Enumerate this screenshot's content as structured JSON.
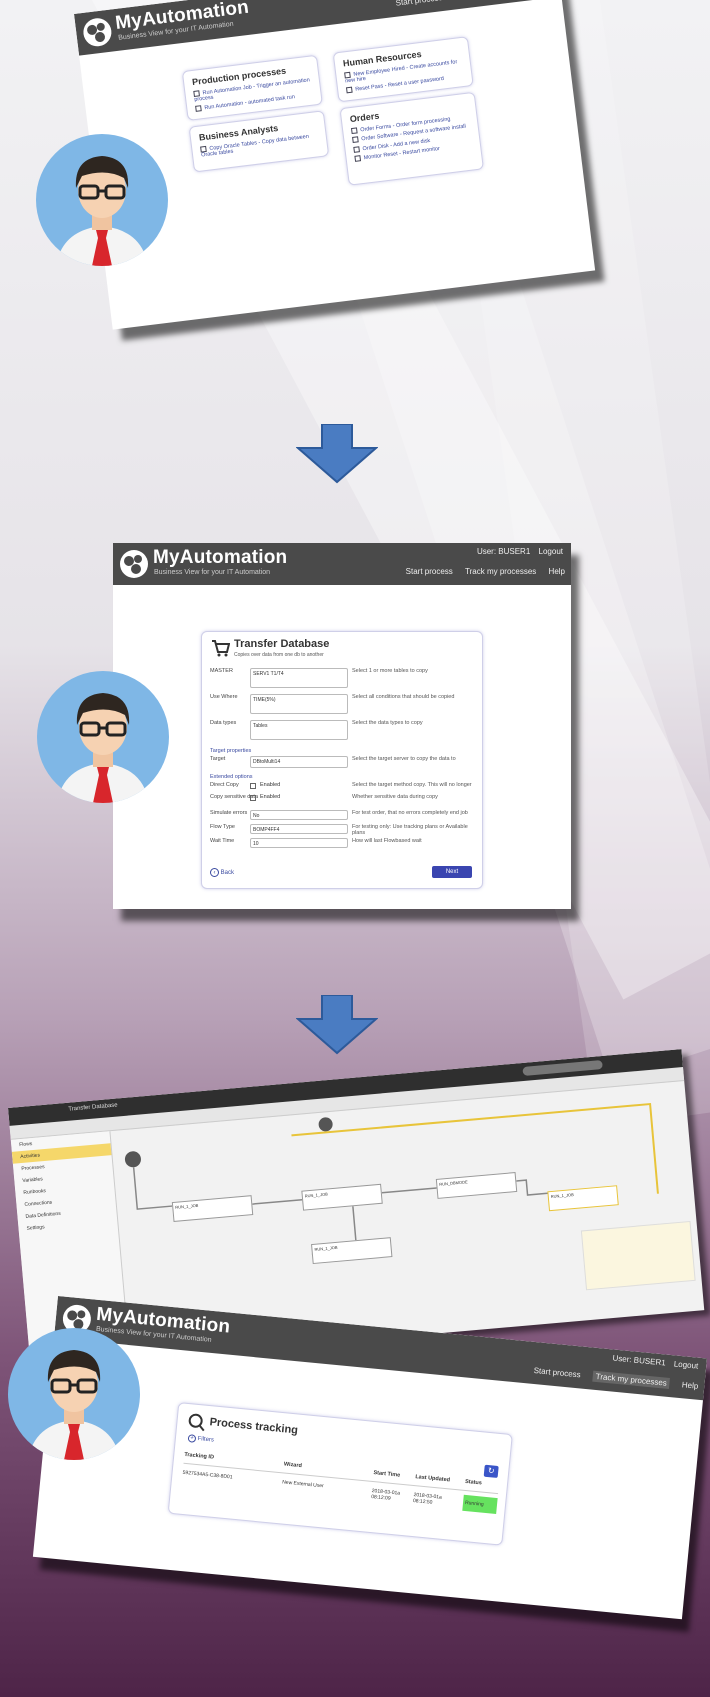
{
  "brand": {
    "name": "MyAutomation",
    "tagline": "Business View for your IT Automation"
  },
  "header": {
    "user": "User: BUSER1",
    "logout": "Logout",
    "start_process": "Start process",
    "track_processes": "Track my processes",
    "help": "Help"
  },
  "screen1": {
    "categories": [
      {
        "title": "Production processes",
        "items": [
          "Run Automation Job - Trigger an automation process",
          "Run Automation - automated task run"
        ]
      },
      {
        "title": "Human Resources",
        "items": [
          "New Employee Hired - Create accounts for new hire",
          "Reset Pass - Reset a user password"
        ]
      },
      {
        "title": "Business Analysts",
        "items": [
          "Copy Oracle Tables - Copy data between Oracle tables"
        ]
      },
      {
        "title": "Orders",
        "items": [
          "Order Forms - Order form processing",
          "Order Software - Request a software install",
          "Order Disk - Add a new disk",
          "Monitor Reset - Restart monitor"
        ]
      }
    ]
  },
  "screen2": {
    "title": "Transfer Database",
    "subtitle": "Copies over data from one db to another",
    "fields": [
      {
        "label": "MASTER",
        "value": "SERV1 T1/T4",
        "hint": "Select 1 or more tables to copy"
      },
      {
        "label": "Use Where",
        "value": "TIME(5%)",
        "hint": "Select all conditions that should be copied"
      },
      {
        "label": "Data types",
        "value": "Tables",
        "hint": "Select the data types to copy"
      }
    ],
    "target_section": "Target properties",
    "target": {
      "label": "Target",
      "value": "DBtoMulti14",
      "hint": "Select the target server to copy the data to"
    },
    "extended_section": "Extended options",
    "options": [
      {
        "label": "Direct Copy",
        "value": "Enabled",
        "hint": "Select the target method copy. This will no longer"
      },
      {
        "label": "Copy sensitive data",
        "value": "Enabled",
        "hint": "Whether sensitive data during copy"
      },
      {
        "label": "Simulate errors",
        "value": "No",
        "hint": "For test order, that no errors completely end job"
      },
      {
        "label": "Flow Type",
        "value": "BOMP4FF4",
        "hint": "For testing only: Use tracking plans or Available plans"
      },
      {
        "label": "Wait Time",
        "value": "10",
        "hint": "How will last Flowbased wait"
      }
    ],
    "back": "Back",
    "next": "Next"
  },
  "screen3": {
    "workflow_tab": "Transfer Database",
    "nodes": [
      "RUN_1_JOB",
      "RUN_1_JOB",
      "RUN_DBMODE",
      "RUN_1_JOB",
      "RUN_1_JOB"
    ],
    "sidebar_items": [
      "Flows",
      "Activities",
      "Processes",
      "Variables",
      "Runbooks",
      "Connections",
      "Data Definitions",
      "Settings"
    ],
    "tracking": {
      "title": "Process tracking",
      "filters": "Filters",
      "columns": [
        "Tracking ID",
        "Wizard",
        "Start Time",
        "Last Updated",
        "Status"
      ],
      "rows": [
        {
          "id": "5927534A5-C38-8D01",
          "wizard": "New External User",
          "start": "2018-03-01a 08:12:09",
          "updated": "2018-03-01a 08:12:50",
          "status": "Running"
        }
      ],
      "status_color": "#66e25f"
    }
  }
}
